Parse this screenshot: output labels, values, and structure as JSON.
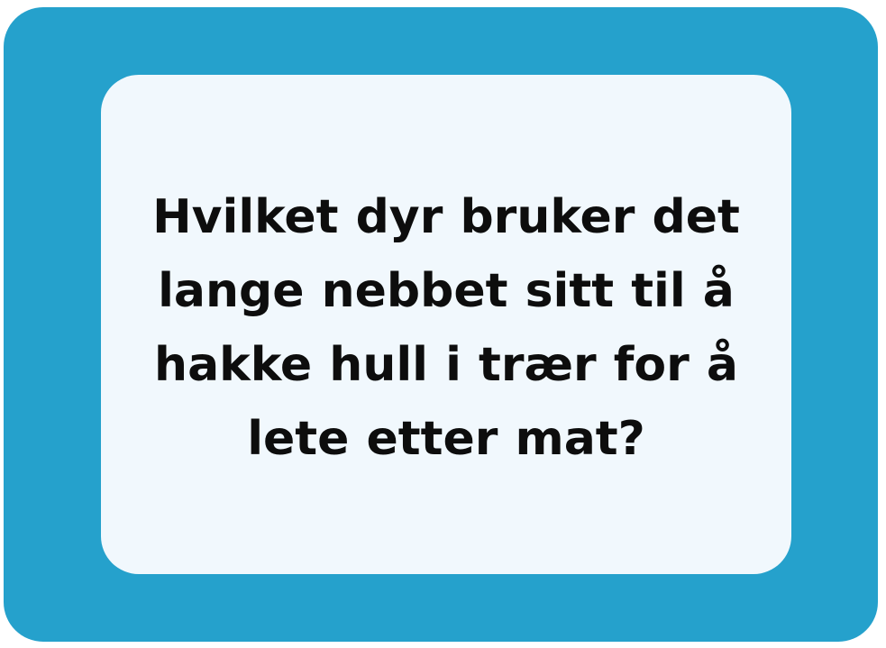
{
  "card": {
    "question": "Hvilket dyr bruker det lange nebbet sitt til å hakke hull i trær for å lete etter mat?",
    "colors": {
      "frame": "#25a1cc",
      "panel": "#f1f8fd",
      "text": "#0d0d0d"
    }
  }
}
